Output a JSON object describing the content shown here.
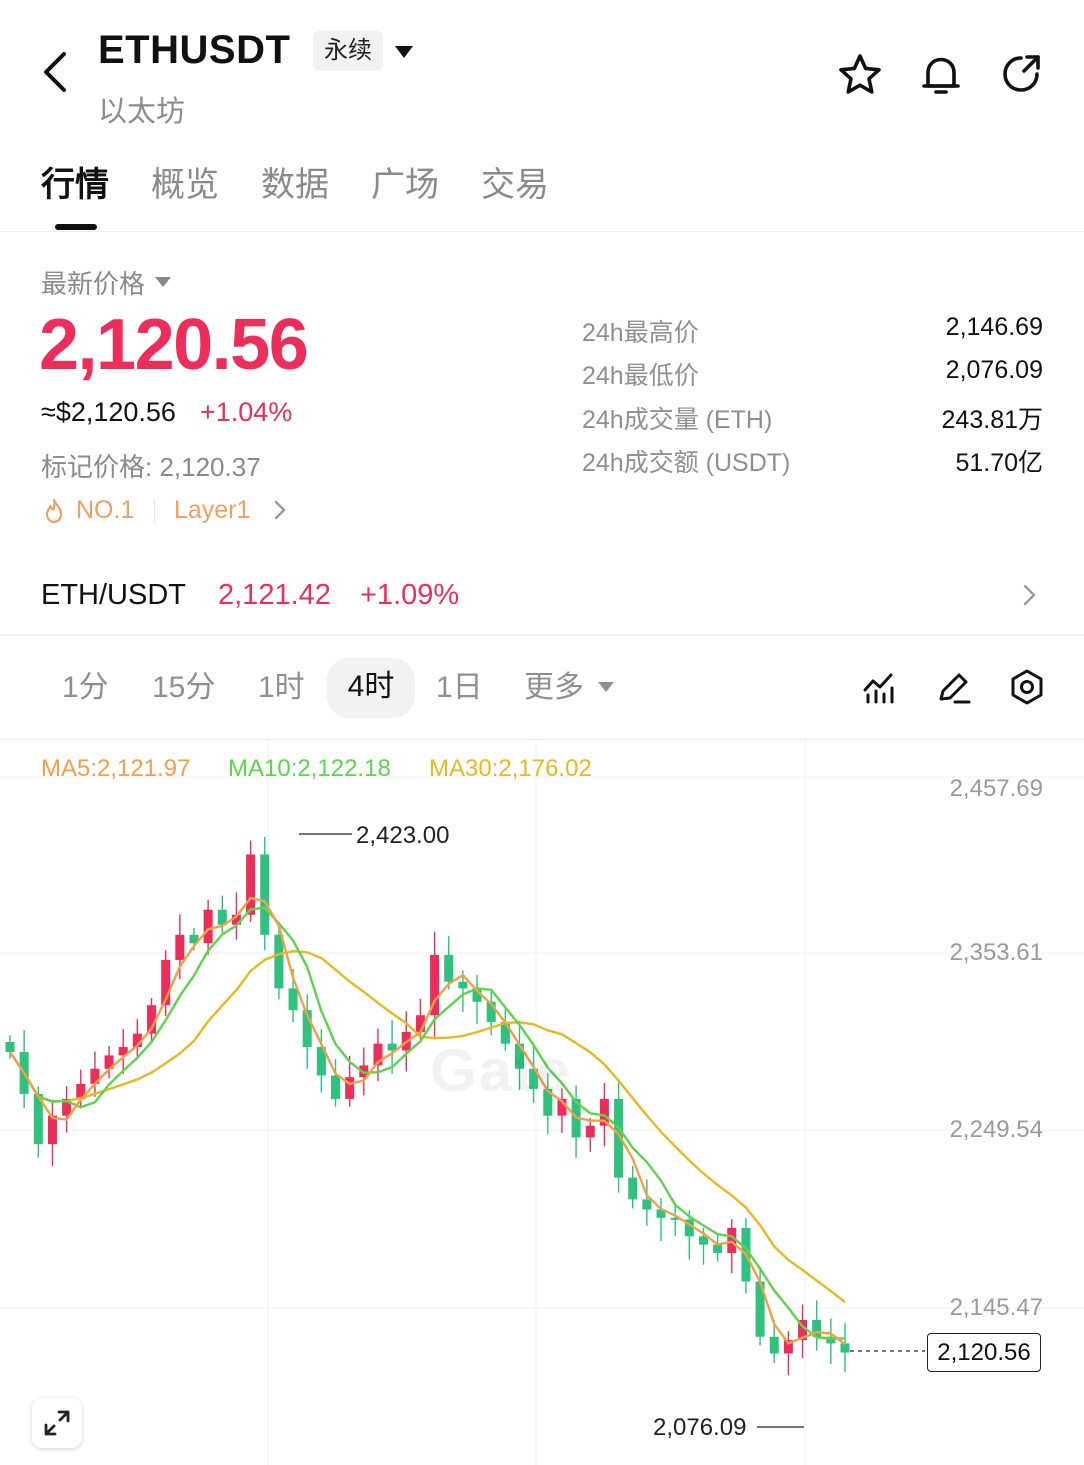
{
  "header": {
    "symbol": "ETHUSDT",
    "contract_type": "永续",
    "subtitle": "以太坊"
  },
  "tabs": [
    {
      "label": "行情",
      "active": true
    },
    {
      "label": "概览",
      "active": false
    },
    {
      "label": "数据",
      "active": false
    },
    {
      "label": "广场",
      "active": false
    },
    {
      "label": "交易",
      "active": false
    }
  ],
  "price": {
    "label": "最新价格",
    "last": "2,120.56",
    "usd": "≈$2,120.56",
    "change_pct": "+1.04%",
    "mark_price": "标记价格: 2,120.37",
    "tags": {
      "rank": "NO.1",
      "sector": "Layer1"
    }
  },
  "stats": [
    {
      "label": "24h最高价",
      "value": "2,146.69"
    },
    {
      "label": "24h最低价",
      "value": "2,076.09"
    },
    {
      "label": "24h成交量 (ETH)",
      "value": "243.81万"
    },
    {
      "label": "24h成交额 (USDT)",
      "value": "51.70亿"
    }
  ],
  "spot": {
    "pair": "ETH/USDT",
    "price": "2,121.42",
    "change_pct": "+1.09%"
  },
  "intervals": {
    "items": [
      "1分",
      "15分",
      "1时",
      "4时",
      "1日",
      "更多"
    ],
    "selected": "4时"
  },
  "colors": {
    "up": "#ee2e5a",
    "down": "#2ec27e",
    "ma5": "#f0a04a",
    "ma10": "#5cd44c",
    "ma30": "#e8b820"
  },
  "chart_data": {
    "type": "candlestick",
    "interval": "4时",
    "ma": {
      "MA5": "MA5:2,121.97",
      "MA10": "MA10:2,122.18",
      "MA30": "MA30:2,176.02"
    },
    "y_axis_ticks": [
      "2,457.69",
      "2,353.61",
      "2,249.54",
      "2,145.47"
    ],
    "ylim": [
      2076.09,
      2457.69
    ],
    "high_marker": "2,423.00",
    "low_marker": "2,076.09",
    "current_price": "2,120.56",
    "watermark": "Gate",
    "closes_approx": [
      2300,
      2275,
      2245,
      2262,
      2272,
      2281,
      2290,
      2298,
      2303,
      2311,
      2328,
      2355,
      2370,
      2365,
      2385,
      2376,
      2382,
      2418,
      2370,
      2338,
      2325,
      2303,
      2286,
      2272,
      2285,
      2292,
      2305,
      2301,
      2312,
      2322,
      2358,
      2342,
      2338,
      2330,
      2318,
      2305,
      2290,
      2278,
      2262,
      2272,
      2249,
      2256,
      2272,
      2225,
      2212,
      2206,
      2201,
      2200,
      2190,
      2185,
      2180,
      2195,
      2163,
      2130,
      2120,
      2128,
      2140,
      2130,
      2126,
      2120.56
    ]
  }
}
